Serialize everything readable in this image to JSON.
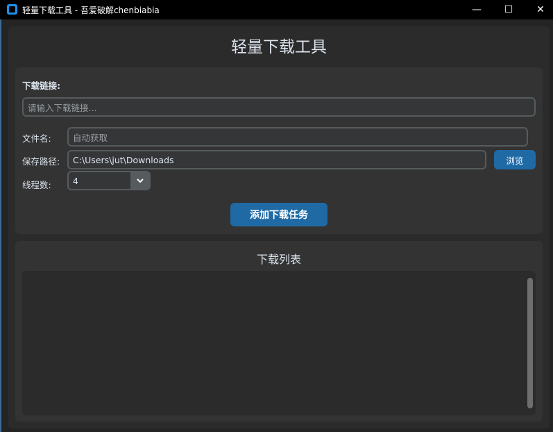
{
  "window": {
    "title": "轻量下载工具 - 吾爱破解chenbiabia",
    "minimize": "—",
    "maximize": "☐",
    "close": "✕"
  },
  "header": {
    "title": "轻量下载工具"
  },
  "form": {
    "url_label": "下载链接:",
    "url_placeholder": "请输入下载链接...",
    "filename_label": "文件名:",
    "filename_placeholder": "自动获取",
    "path_label": "保存路径:",
    "path_value": "C:\\Users\\jut\\Downloads",
    "browse_label": "浏览",
    "threads_label": "线程数:",
    "threads_value": "4",
    "add_label": "添加下载任务"
  },
  "download_list": {
    "title": "下载列表",
    "items": []
  },
  "colors": {
    "accent": "#1f6aa5"
  }
}
